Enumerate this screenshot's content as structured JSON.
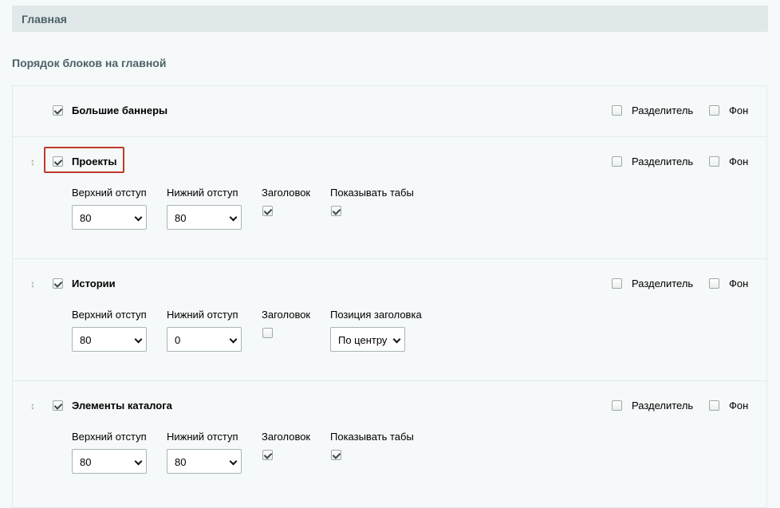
{
  "header": {
    "title": "Главная"
  },
  "section": {
    "title": "Порядок блоков на главной"
  },
  "labels": {
    "separator": "Разделитель",
    "background": "Фон",
    "top_padding": "Верхний отступ",
    "bottom_padding": "Нижний отступ",
    "heading": "Заголовок",
    "show_tabs": "Показывать табы",
    "heading_position": "Позиция заголовка"
  },
  "blocks": [
    {
      "name": "Большие баннеры",
      "enabled": true,
      "separator": false,
      "background": false
    },
    {
      "name": "Проекты",
      "enabled": true,
      "separator": false,
      "background": false,
      "top_padding": "80",
      "bottom_padding": "80",
      "heading": true,
      "show_tabs": true
    },
    {
      "name": "Истории",
      "enabled": true,
      "separator": false,
      "background": false,
      "top_padding": "80",
      "bottom_padding": "0",
      "heading": false,
      "heading_position": "По центру"
    },
    {
      "name": "Элементы каталога",
      "enabled": true,
      "separator": false,
      "background": false,
      "top_padding": "80",
      "bottom_padding": "80",
      "heading": true,
      "show_tabs": true
    }
  ],
  "drag_glyph": "↕"
}
